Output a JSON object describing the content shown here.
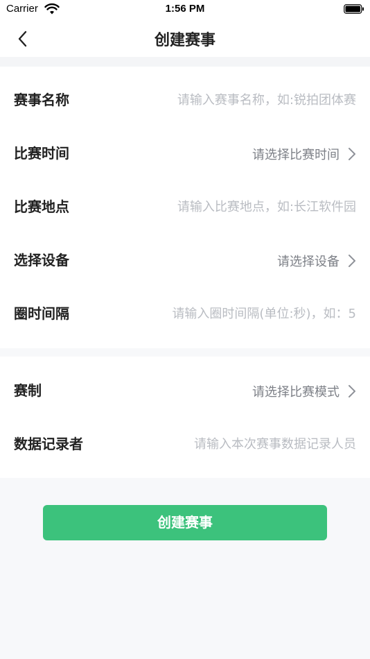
{
  "status_bar": {
    "carrier": "Carrier",
    "time": "1:56 PM"
  },
  "nav": {
    "title": "创建赛事",
    "back_icon": "chevron-left-icon"
  },
  "form": {
    "event_name": {
      "label": "赛事名称",
      "placeholder": "请输入赛事名称，如:锐拍团体赛"
    },
    "match_time": {
      "label": "比赛时间",
      "value": "请选择比赛时间"
    },
    "match_location": {
      "label": "比赛地点",
      "placeholder": "请输入比赛地点，如:长江软件园"
    },
    "device": {
      "label": "选择设备",
      "value": "请选择设备"
    },
    "lap_interval": {
      "label": "圈时间隔",
      "placeholder": "请输入圈时间隔(单位:秒)，如：5"
    },
    "format": {
      "label": "赛制",
      "value": "请选择比赛模式"
    },
    "recorder": {
      "label": "数据记录者",
      "placeholder": "请输入本次赛事数据记录人员"
    }
  },
  "actions": {
    "create_label": "创建赛事"
  },
  "colors": {
    "accent": "#3cc27c",
    "placeholder": "#b9bcc2",
    "background": "#f7f8fa"
  }
}
